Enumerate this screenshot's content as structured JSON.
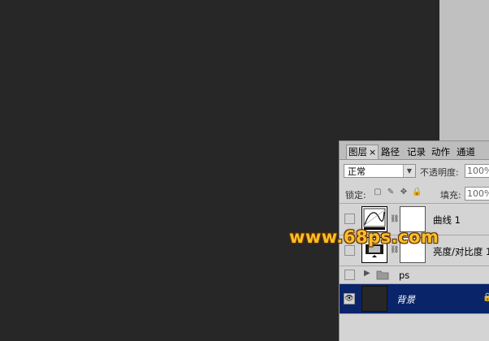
{
  "tabs": [
    {
      "label": "图层",
      "close": "×"
    },
    {
      "label": "路径"
    },
    {
      "label": "记录"
    },
    {
      "label": "动作"
    },
    {
      "label": "通道"
    }
  ],
  "blend_mode": {
    "value": "正常"
  },
  "opacity": {
    "label": "不透明度:",
    "value": "100%"
  },
  "lock": {
    "label": "锁定:"
  },
  "fill": {
    "label": "填充:",
    "value": "100%"
  },
  "layers": [
    {
      "name": "曲线 1"
    },
    {
      "name": "亮度/对比度 1"
    },
    {
      "name": "ps"
    },
    {
      "name": "背景"
    }
  ],
  "watermark": "www.68ps.com",
  "colors": {
    "canvas": "#272727",
    "panel": "#d4d4d4",
    "selection": "#0a246a",
    "watermark": "#f6c02a"
  }
}
